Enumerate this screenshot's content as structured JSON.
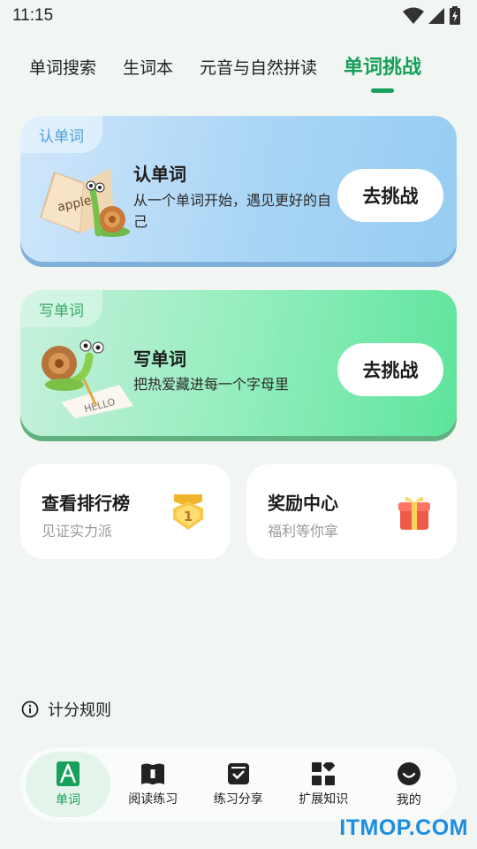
{
  "status_bar": {
    "time": "11:15"
  },
  "top_tabs": [
    {
      "label": "单词搜索",
      "active": false
    },
    {
      "label": "生词本",
      "active": false
    },
    {
      "label": "元音与自然拼读",
      "active": false
    },
    {
      "label": "单词挑战",
      "active": true
    }
  ],
  "cards": [
    {
      "tag": "认单词",
      "title": "认单词",
      "desc": "从一个单词开始，遇见更好的自己",
      "button": "去挑战",
      "illustration_text": "apple"
    },
    {
      "tag": "写单词",
      "title": "写单词",
      "desc": "把热爱藏进每一个字母里",
      "button": "去挑战",
      "illustration_text": "HELLO"
    }
  ],
  "features": [
    {
      "title": "查看排行榜",
      "subtitle": "见证实力派",
      "icon": "medal-icon",
      "badge_text": "1"
    },
    {
      "title": "奖励中心",
      "subtitle": "福利等你拿",
      "icon": "gift-icon"
    }
  ],
  "rules_link": {
    "label": "计分规则",
    "icon": "info-icon"
  },
  "bottom_nav": [
    {
      "label": "单词",
      "icon": "word-a-icon",
      "active": true
    },
    {
      "label": "阅读练习",
      "icon": "book-icon",
      "active": false
    },
    {
      "label": "练习分享",
      "icon": "share-box-icon",
      "active": false
    },
    {
      "label": "扩展知识",
      "icon": "grid-icon",
      "active": false
    },
    {
      "label": "我的",
      "icon": "smile-icon",
      "active": false
    }
  ],
  "watermark": "ITMOP.COM",
  "colors": {
    "accent": "#16a05a",
    "watermark": "#1b8de0"
  }
}
